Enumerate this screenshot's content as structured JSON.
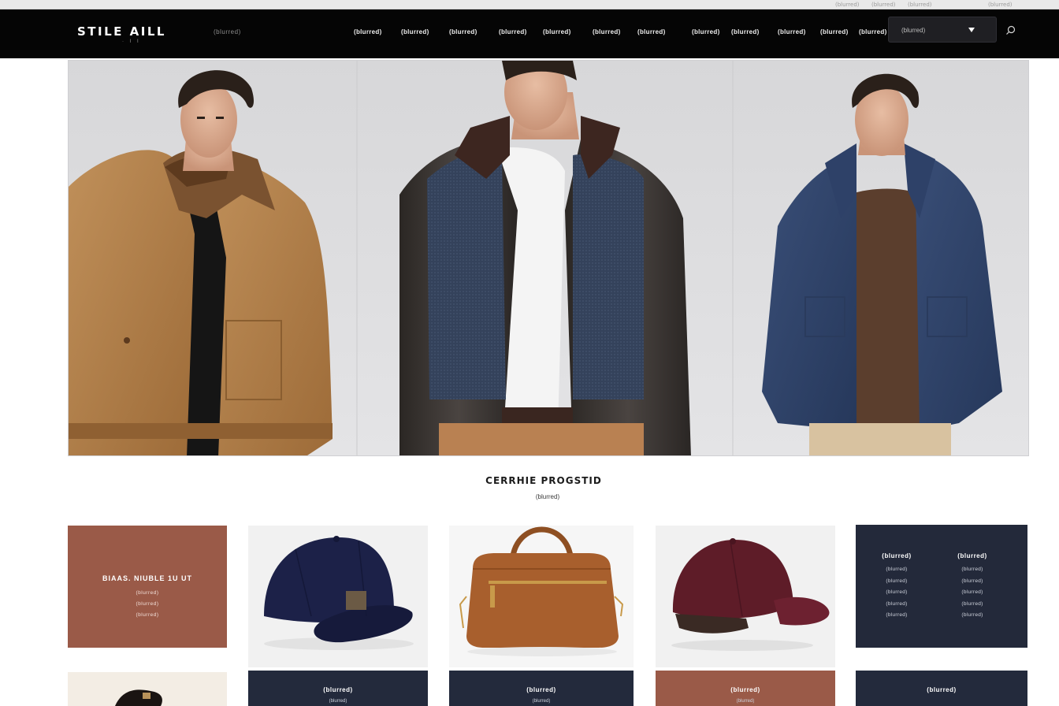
{
  "browser": {
    "labels": [
      "(blurred)",
      "(blurred)",
      "(blurred)",
      "(blurred)"
    ]
  },
  "nav": {
    "logo": "STILE AILL",
    "logo_sub": "· I I",
    "tagline": "(blurred)",
    "menu": [
      "(blurred)",
      "(blurred)",
      "(blurred)",
      "(blurred)",
      "(blurred)",
      "(blurred)",
      "(blurred)",
      "(blurred)",
      "(blurred)",
      "(blurred)",
      "(blurred)",
      "(blurred)"
    ],
    "dropdown_value": "(blurred)",
    "search_icon": "search-icon"
  },
  "hero": {
    "models": [
      "camel-jacket-model",
      "leather-denim-jacket-model",
      "denim-jacket-model"
    ]
  },
  "featured": {
    "title": "CERRHIE PROGSTID",
    "description": "(blurred)"
  },
  "promo": {
    "title": "BIAAS. NIUBLE 1U UT",
    "lines": [
      "(blurred)",
      "(blurred)",
      "(blurred)"
    ]
  },
  "products": [
    {
      "name": "(blurred)",
      "image": "navy-cap",
      "sub": "(blurred)"
    },
    {
      "name": "(blurred)",
      "image": "leather-bag",
      "sub": "(blurred)"
    },
    {
      "name": "(blurred)",
      "image": "burgundy-cap",
      "sub": "(blurred)"
    }
  ],
  "links_card": {
    "col1": {
      "heading": "(blurred)",
      "items": [
        "(blurred)",
        "(blurred)",
        "(blurred)",
        "(blurred)",
        "(blurred)"
      ]
    },
    "col2": {
      "heading": "(blurred)",
      "items": [
        "(blurred)",
        "(blurred)",
        "(blurred)",
        "(blurred)",
        "(blurred)"
      ]
    },
    "band_title": "(blurred)"
  },
  "colors": {
    "nav_bg": "#050505",
    "rust": "#9a5a48",
    "navy": "#23293a",
    "page_bg": "#ffffff"
  }
}
